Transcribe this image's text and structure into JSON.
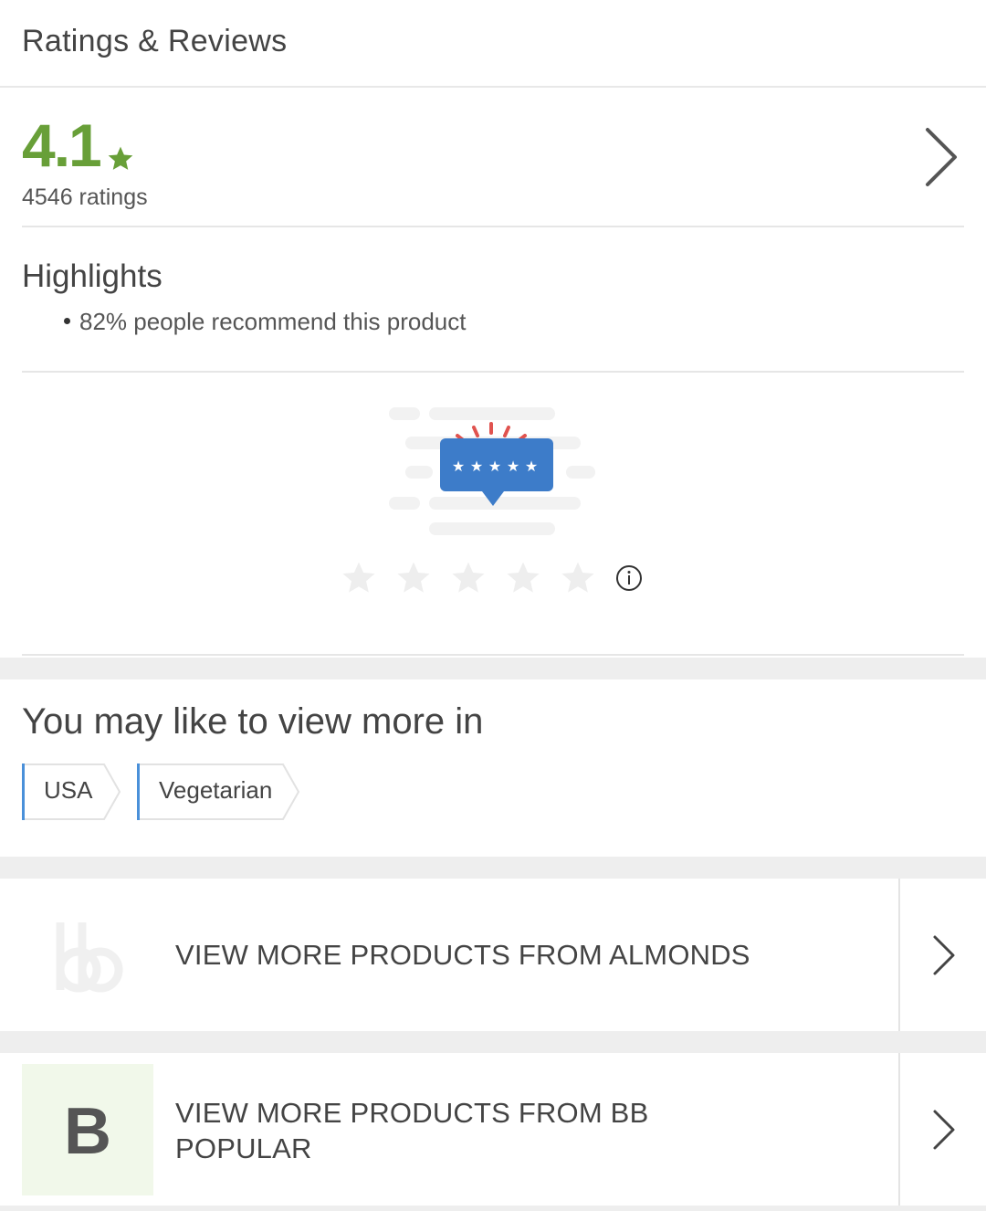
{
  "header": {
    "title": "Ratings & Reviews"
  },
  "rating": {
    "value": "4.1",
    "count_label": "4546 ratings",
    "accent": "#689f38"
  },
  "highlights": {
    "title": "Highlights",
    "items": [
      "82% people recommend this product"
    ]
  },
  "rate_prompt": {
    "stars": 5,
    "illustration": "rating-speech-bubble-illustration"
  },
  "more": {
    "title": "You may like to view more in",
    "tags": [
      "USA",
      "Vegetarian"
    ]
  },
  "brand_links": [
    {
      "label": "VIEW MORE PRODUCTS FROM ALMONDS",
      "logo": "bb-logo"
    },
    {
      "label": "VIEW MORE PRODUCTS FROM BB POPULAR",
      "logo_text": "B"
    }
  ],
  "colors": {
    "tag_accent": "#4a90d9",
    "bubble": "#3d7cc9",
    "spark": "#e0534f"
  }
}
